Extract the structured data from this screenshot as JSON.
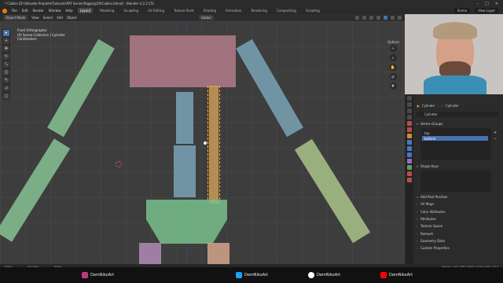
{
  "window": {
    "title": "* Cables [D:\\Aktuelle Projekte\\Tutorials\\PAT Series\\Rigging\\20\\Cables.blend] - Blender 4.2.2 LTS"
  },
  "menu": {
    "items": [
      "File",
      "Edit",
      "Render",
      "Window",
      "Help"
    ],
    "tabs": [
      "Layout",
      "Modeling",
      "Sculpting",
      "UV Editing",
      "Texture Paint",
      "Shading",
      "Animation",
      "Rendering",
      "Compositing",
      "Scripting"
    ],
    "active_tab": "Layout",
    "scene_label": "Scene",
    "view_layer_label": "View Layer"
  },
  "viewport_header": {
    "mode": "Object Mode",
    "menus": [
      "View",
      "Select",
      "Add",
      "Object"
    ],
    "transform": "Global"
  },
  "viewport": {
    "view_name": "Front Orthographic",
    "collection": "(0) Scene Collection | Cylinder",
    "units": "Centimeters",
    "options_label": "Options"
  },
  "properties": {
    "breadcrumb_object": "Cylinder",
    "breadcrumb_data": "Cylinder",
    "mesh_name": "Cylinder",
    "vertex_groups_label": "Vertex Groups",
    "vertex_groups": [
      {
        "name": "top",
        "selected": false
      },
      {
        "name": "bottom",
        "selected": true
      }
    ],
    "shape_keys_label": "Shape Keys",
    "sections": [
      "Add Rest Position",
      "UV Maps",
      "Color Attributes",
      "Attributes",
      "Texture Space",
      "Remesh",
      "Geometry Data",
      "Custom Properties"
    ]
  },
  "status": {
    "left": [
      "Select",
      "Pan View",
      "Object"
    ],
    "memory": "Memory: 143.7 MiB | VRAM: 2.3/12.0 GiB | 4.2.2"
  },
  "socials": [
    {
      "name": "instagram",
      "handle": "DemNikoArt",
      "color": "#c13584"
    },
    {
      "name": "twitter",
      "handle": "DemNikoArt",
      "color": "#1da1f2"
    },
    {
      "name": "patreon",
      "handle": "DemNikoArt",
      "color": "#ffffff"
    },
    {
      "name": "youtube",
      "handle": "DemNikoArt",
      "color": "#ff0000"
    }
  ]
}
